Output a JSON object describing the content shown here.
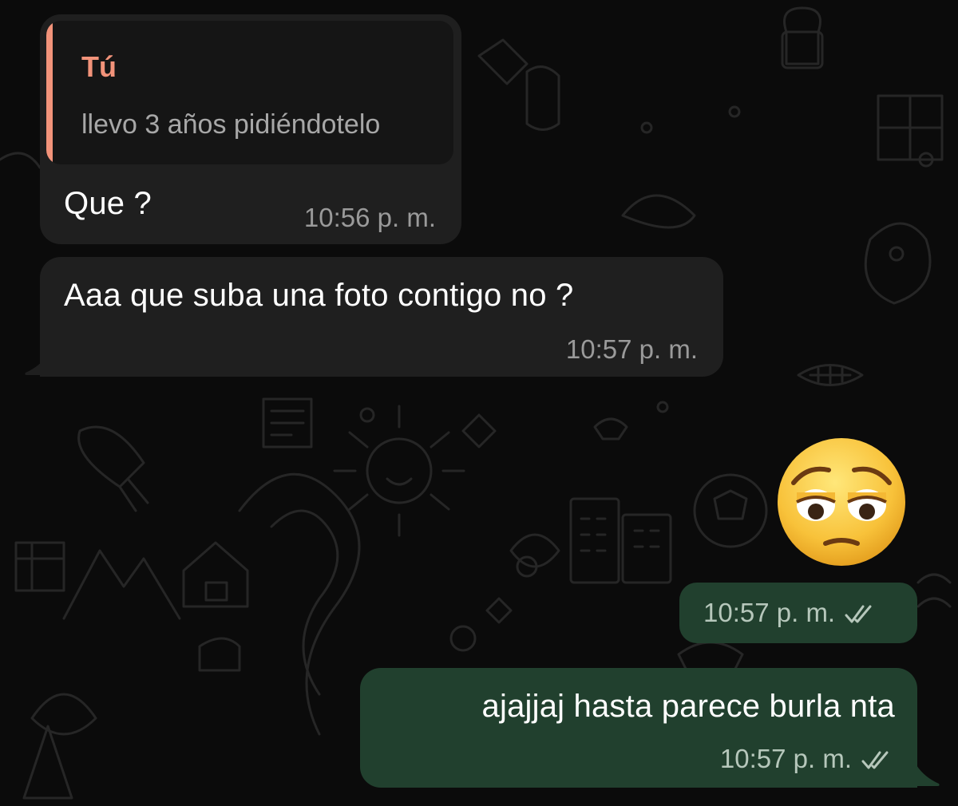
{
  "theme": {
    "background": "#0b0b0b",
    "incoming_bubble": "#1f1f1f",
    "outgoing_bubble": "#21402e",
    "reply_accent": "#f2937a"
  },
  "messages": [
    {
      "direction": "incoming",
      "reply": {
        "author": "Tú",
        "text": "llevo 3 años pidiéndotelo"
      },
      "text": "Que ?",
      "time": "10:56 p. m."
    },
    {
      "direction": "incoming",
      "text": "Aaa que suba una foto contigo no ?",
      "time": "10:57 p. m."
    },
    {
      "direction": "outgoing",
      "emoji": "pensive-face",
      "time": "10:57 p. m.",
      "status": "read-double-check-icon"
    },
    {
      "direction": "outgoing",
      "text": "ajajjaj hasta parece burla nta",
      "time": "10:57 p. m.",
      "status": "read-double-check-icon"
    }
  ]
}
